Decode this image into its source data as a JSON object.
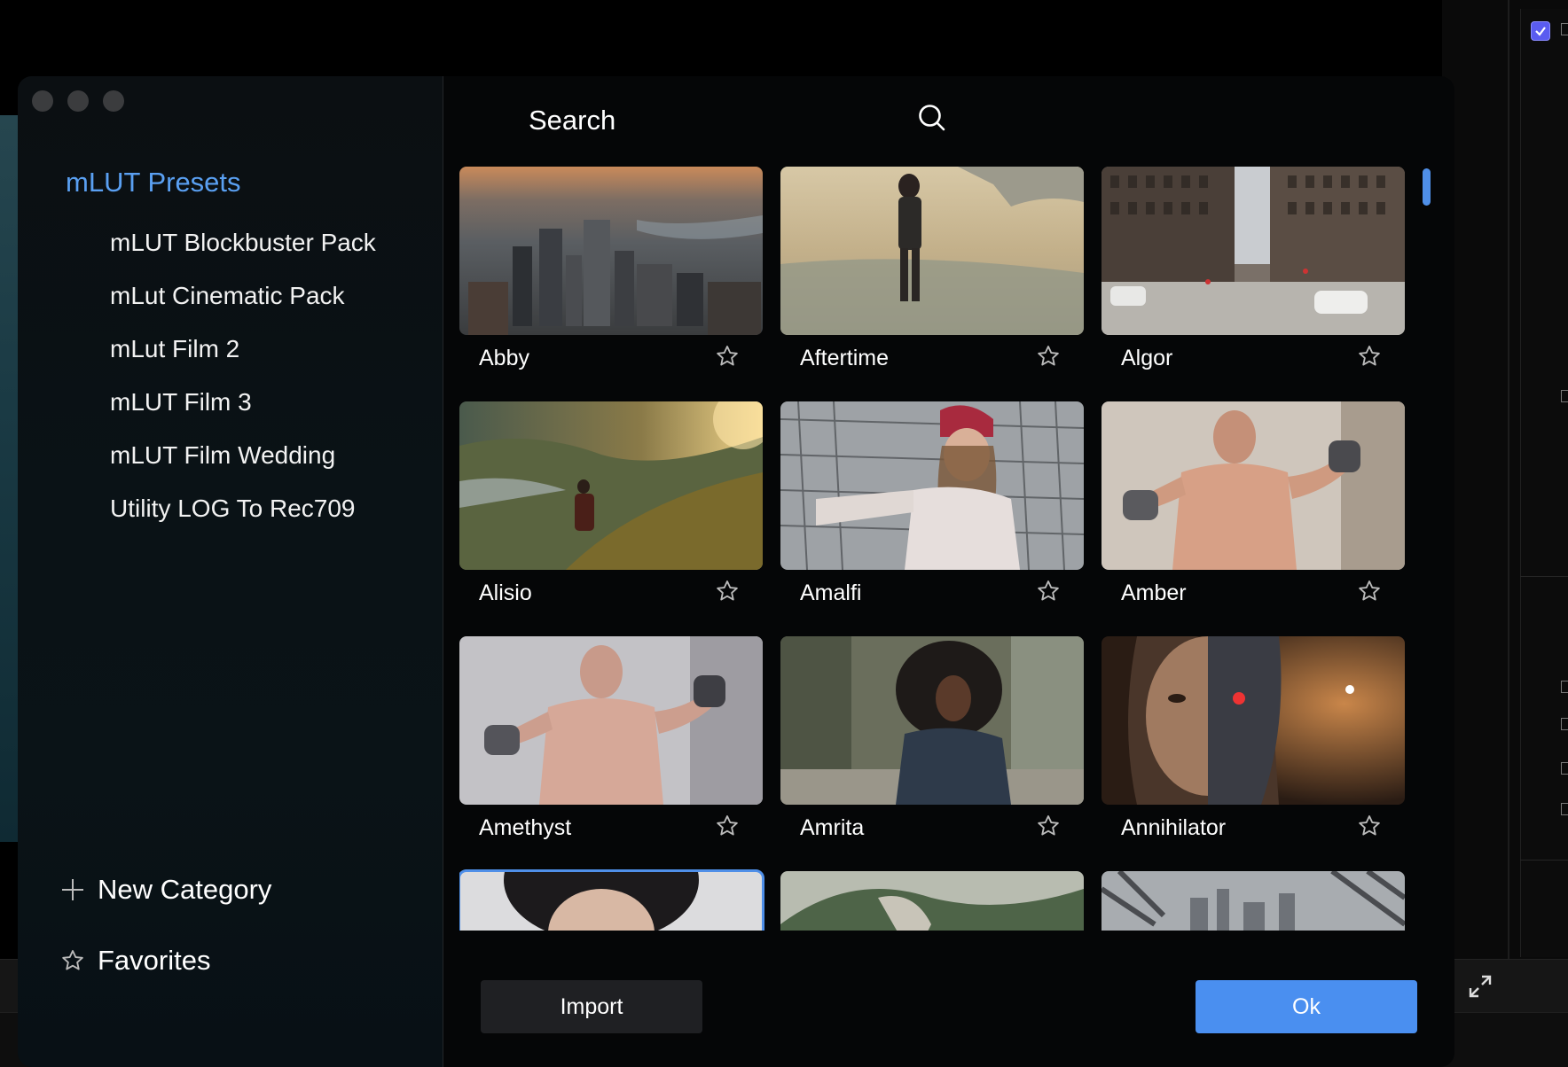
{
  "window": {
    "controls": [
      "close",
      "minimize",
      "zoom"
    ]
  },
  "sidebar": {
    "heading": "mLUT Presets",
    "items": [
      {
        "label": "mLUT Blockbuster Pack"
      },
      {
        "label": "mLut Cinematic Pack"
      },
      {
        "label": "mLut Film 2"
      },
      {
        "label": "mLUT Film 3"
      },
      {
        "label": "mLUT Film Wedding"
      },
      {
        "label": "Utility LOG To Rec709"
      }
    ],
    "new_category_label": "New Category",
    "favorites_label": "Favorites"
  },
  "search": {
    "title": "Search",
    "icon": "search-icon"
  },
  "grid": {
    "presets": [
      {
        "name": "Abby",
        "thumb": "aerial-city",
        "favorite": false
      },
      {
        "name": "Aftertime",
        "thumb": "beach-walker",
        "favorite": false
      },
      {
        "name": "Algor",
        "thumb": "city-street",
        "favorite": false
      },
      {
        "name": "Alisio",
        "thumb": "mountain-sunset",
        "favorite": false
      },
      {
        "name": "Amalfi",
        "thumb": "woman-beanie",
        "favorite": false
      },
      {
        "name": "Amber",
        "thumb": "boxer",
        "favorite": false
      },
      {
        "name": "Amethyst",
        "thumb": "boxer",
        "favorite": false
      },
      {
        "name": "Amrita",
        "thumb": "woman-curly",
        "favorite": false
      },
      {
        "name": "Annihilator",
        "thumb": "cyborg-face",
        "favorite": false
      },
      {
        "name": "",
        "thumb": "portrait-bangs",
        "selected": true
      },
      {
        "name": "",
        "thumb": "green-cliffs"
      },
      {
        "name": "",
        "thumb": "bridge-city"
      }
    ]
  },
  "buttons": {
    "import_label": "Import",
    "ok_label": "Ok"
  },
  "colors": {
    "accent": "#4a8ff0",
    "heading": "#5aa0f2",
    "background": "#050607"
  }
}
